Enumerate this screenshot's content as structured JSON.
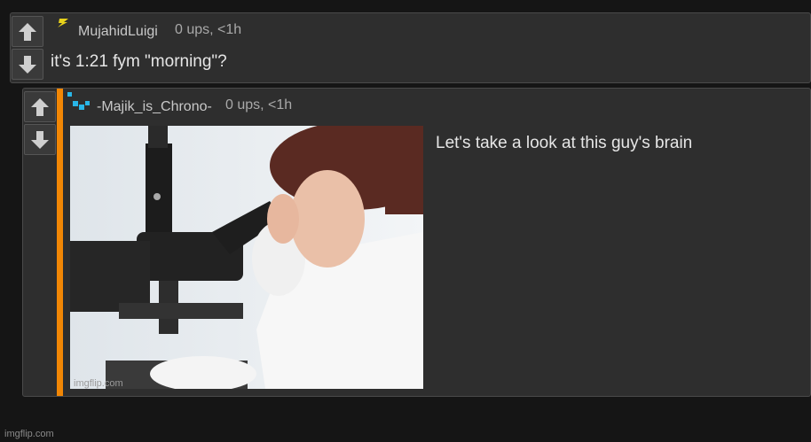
{
  "comments": [
    {
      "author": "MujahidLuigi",
      "meta": "0 ups, <1h",
      "text": "it's 1:21 fym \"morning\"?",
      "badge_icon": "lightning-bolt-icon",
      "badge_color": "#e8d21a"
    },
    {
      "author": "-Majik_is_Chrono-",
      "meta": "0 ups, <1h",
      "text": "Let's take a look at this guy's brain",
      "badge_icon": "pixel-dots-icon",
      "badge_color": "#29b6e8",
      "image_watermark": "imgflip.com"
    }
  ],
  "footer_watermark": "imgflip.com",
  "colors": {
    "background": "#151515",
    "comment_bg": "#2e2e2e",
    "thread_bar": "#f28705"
  }
}
